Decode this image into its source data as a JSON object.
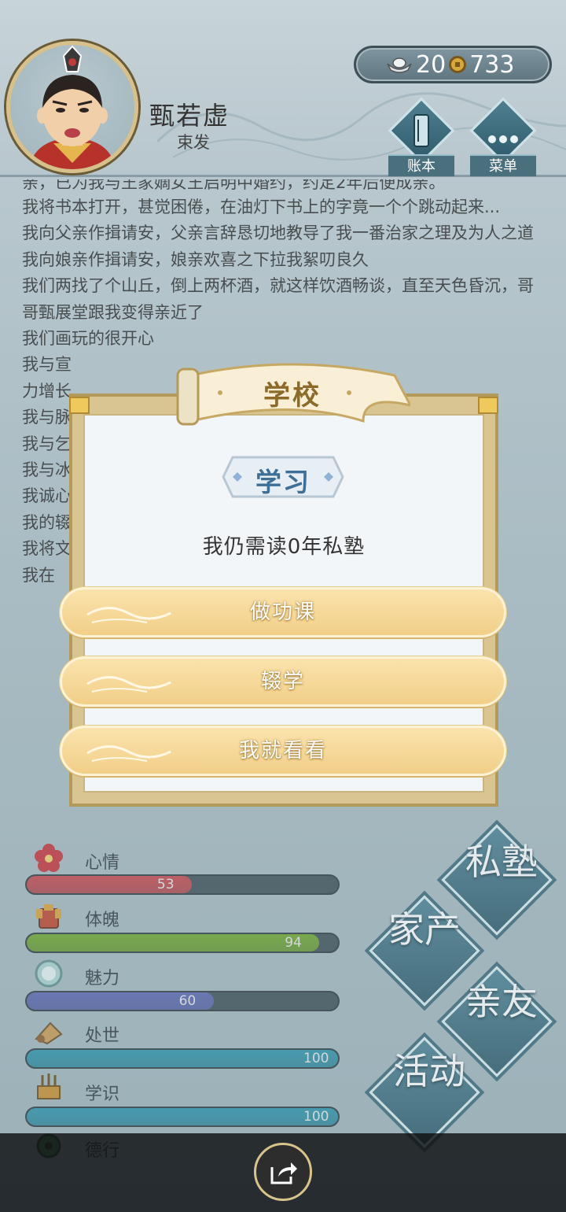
{
  "header": {
    "name": "甄若虚",
    "rank": "束发",
    "silver": "20",
    "coins": "733",
    "account_label": "账本",
    "menu_label": "菜单"
  },
  "story": [
    "亲，已为我与王家嫡女王启明中婚约，约定2年后便成亲。",
    "我将书本打开，甚觉困倦，在油灯下书上的字竟一个个跳动起来...",
    "我向父亲作揖请安，父亲言辞恳切地教导了我一番治家之理及为人之道",
    "我向娘亲作揖请安，娘亲欢喜之下拉我絮叨良久",
    "我们两找了个山丘，倒上两杯酒，就这样饮酒畅谈，直至天色昏沉，哥哥甄展堂跟我变得亲近了",
    "我们画玩的很开心",
    "我与宣",
    "力增长",
    "我与脉",
    "我与乞",
    "我与冰",
    "我诚心",
    "我的辍",
    "我将文",
    "我在"
  ],
  "modal": {
    "title": "学校",
    "tag": "学习",
    "message": "我仍需读0年私塾",
    "options": [
      "做功课",
      "辍学",
      "我就看看"
    ]
  },
  "stats": [
    {
      "label": "心情",
      "value": 53,
      "color": "#c9464c"
    },
    {
      "label": "体魄",
      "value": 94,
      "color": "#6fa82a"
    },
    {
      "label": "魅力",
      "value": 60,
      "color": "#5b67b3"
    },
    {
      "label": "处世",
      "value": 100,
      "color": "#2d95ad"
    },
    {
      "label": "学识",
      "value": 100,
      "color": "#2d95ad"
    },
    {
      "label": "德行",
      "value": null,
      "color": "#4b8a2c"
    }
  ],
  "actions": {
    "school": "私塾",
    "family": "家产",
    "friends": "亲友",
    "activity": "活动"
  }
}
